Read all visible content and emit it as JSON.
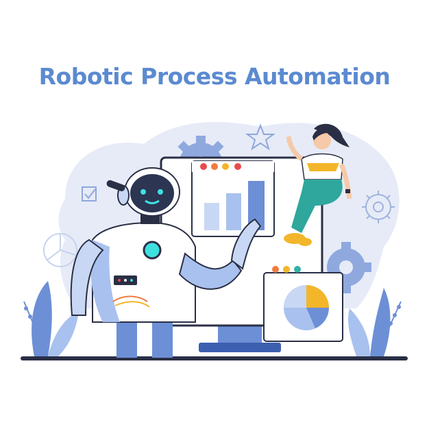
{
  "title": "Robotic Process Automation",
  "colors": {
    "title": "#5b8ad0",
    "blob": "#e6ebf7",
    "primary_blue": "#6c8fd6",
    "light_blue": "#a9c1ee",
    "pale_blue": "#c8d7f3",
    "navy": "#1f2a4a",
    "robot_head": "#2c3552",
    "robot_eye": "#3fe0e0",
    "accent_yellow": "#f3b62a",
    "accent_orange": "#f07b3f",
    "accent_red": "#e84b4b",
    "accent_teal": "#2fb2a8",
    "woman_pants": "#2fa79c",
    "ground": "#2a2f45"
  },
  "icons": [
    "star-icon",
    "checkbox-icon",
    "gear-icon",
    "pie-chart-icon",
    "bar-chart-icon",
    "robot-icon",
    "woman-figure-icon",
    "monitor-icon",
    "plant-icon"
  ]
}
